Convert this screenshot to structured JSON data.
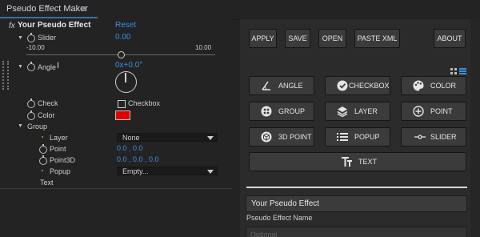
{
  "panel": {
    "title": "Pseudo Effect Maker",
    "menu_icon": "hamburger-icon"
  },
  "effect": {
    "fx": "fx",
    "name": "Your Pseudo Effect",
    "reset": "Reset"
  },
  "params": {
    "slider": {
      "label": "Slider",
      "value": "0.00",
      "min": "-10.00",
      "max": "10.00",
      "level": 0.5
    },
    "angle": {
      "label": "Angle",
      "value": "0x+0.0°"
    },
    "check": {
      "label": "Check",
      "checkbox_label": "Checkbox",
      "checked": false
    },
    "color": {
      "label": "Color",
      "swatch": "#e00000"
    },
    "group": {
      "label": "Group"
    },
    "layer": {
      "label": "Layer",
      "value": "None"
    },
    "point": {
      "label": "Point",
      "value": "0.0 , 0.0"
    },
    "point3d": {
      "label": "Point3D",
      "value": "0.0 , 0.0 , 0.0"
    },
    "popup": {
      "label": "Popup",
      "value": "Empty..."
    },
    "text": {
      "label": "Text"
    }
  },
  "toolbar": {
    "apply": "APPLY",
    "save": "SAVE",
    "open": "OPEN",
    "paste_xml": "PASTE XML",
    "about": "ABOUT"
  },
  "types": {
    "angle": "ANGLE",
    "checkbox": "CHECKBOX",
    "color": "COLOR",
    "group": "GROUP",
    "layer": "LAYER",
    "point": "POINT",
    "point3d": "3D POINT",
    "popup": "POPUP",
    "slider": "SLIDER",
    "text": "TEXT"
  },
  "form": {
    "name_value": "Your Pseudo Effect",
    "name_label": "Pseudo Effect Name",
    "next_placeholder": "Optional"
  },
  "colors": {
    "accent": "#3b8fe0",
    "swatch_red": "#e00000"
  }
}
